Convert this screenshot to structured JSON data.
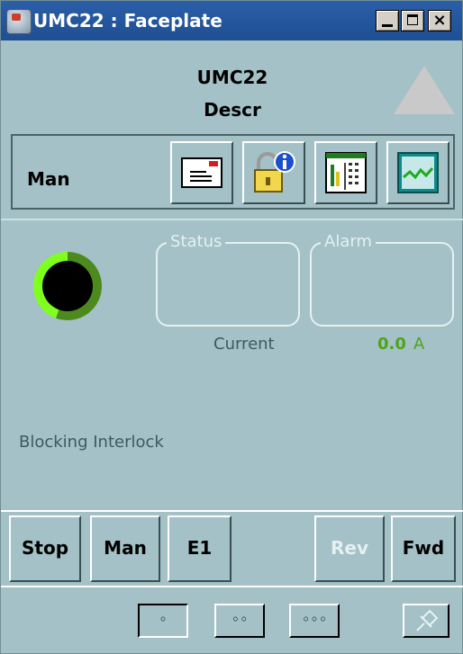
{
  "window": {
    "title": "UMC22 : Faceplate",
    "close_glyph": "×"
  },
  "header": {
    "name": "UMC22",
    "descr": "Descr",
    "indicator_icon": "triangle-up-icon"
  },
  "toolbar": {
    "mode": "Man",
    "buttons": [
      {
        "icon": "message-icon"
      },
      {
        "icon": "lock-info-icon"
      },
      {
        "icon": "parameters-icon"
      },
      {
        "icon": "trend-icon"
      }
    ]
  },
  "status": {
    "motor_icon": "motor-indicator-icon",
    "status_title": "Status",
    "alarm_title": "Alarm",
    "current_label": "Current",
    "current_value": "0.0",
    "current_unit": "A",
    "interlock_text": "Blocking Interlock"
  },
  "commands": {
    "stop": "Stop",
    "man": "Man",
    "e1": "E1",
    "rev": "Rev",
    "fwd": "Fwd"
  },
  "nav": {
    "view1": "◦",
    "view2": "◦◦",
    "view3": "◦◦◦",
    "pin_icon": "pin-icon"
  },
  "colors": {
    "background": "#a3c1c6",
    "value_green": "#4ea41a",
    "titlebar": "#1f4e93"
  }
}
